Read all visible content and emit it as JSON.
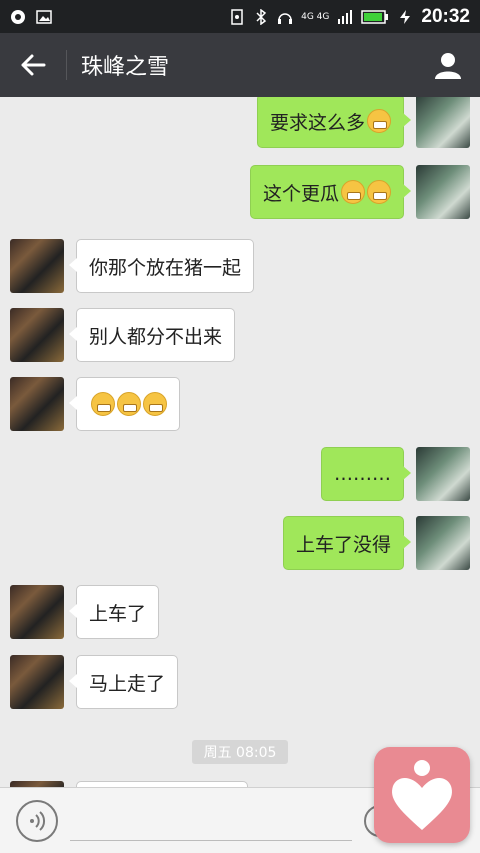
{
  "status_bar": {
    "time": "20:32",
    "network": "4G 4G"
  },
  "header": {
    "title": "珠峰之雪"
  },
  "messages": [
    {
      "side": "out",
      "text": "要求这么多",
      "emoji": [
        "confused"
      ]
    },
    {
      "side": "out",
      "text": "这个更瓜",
      "emoji": [
        "tears-of-joy",
        "tears-of-joy"
      ]
    },
    {
      "side": "in",
      "text": "你那个放在猪一起"
    },
    {
      "side": "in",
      "text": "别人都分不出来"
    },
    {
      "side": "in",
      "text": "",
      "emoji": [
        "grin",
        "grin",
        "grin"
      ]
    },
    {
      "side": "out",
      "text": "………"
    },
    {
      "side": "out",
      "text": "上车了没得"
    },
    {
      "side": "in",
      "text": "上车了"
    },
    {
      "side": "in",
      "text": "马上走了"
    }
  ],
  "timestamp": "周五 08:05",
  "icons": {
    "back": "arrow-left-icon",
    "profile": "person-icon",
    "voice": "voice-icon",
    "emoji": "smiley-icon",
    "float": "heart-person-icon"
  }
}
